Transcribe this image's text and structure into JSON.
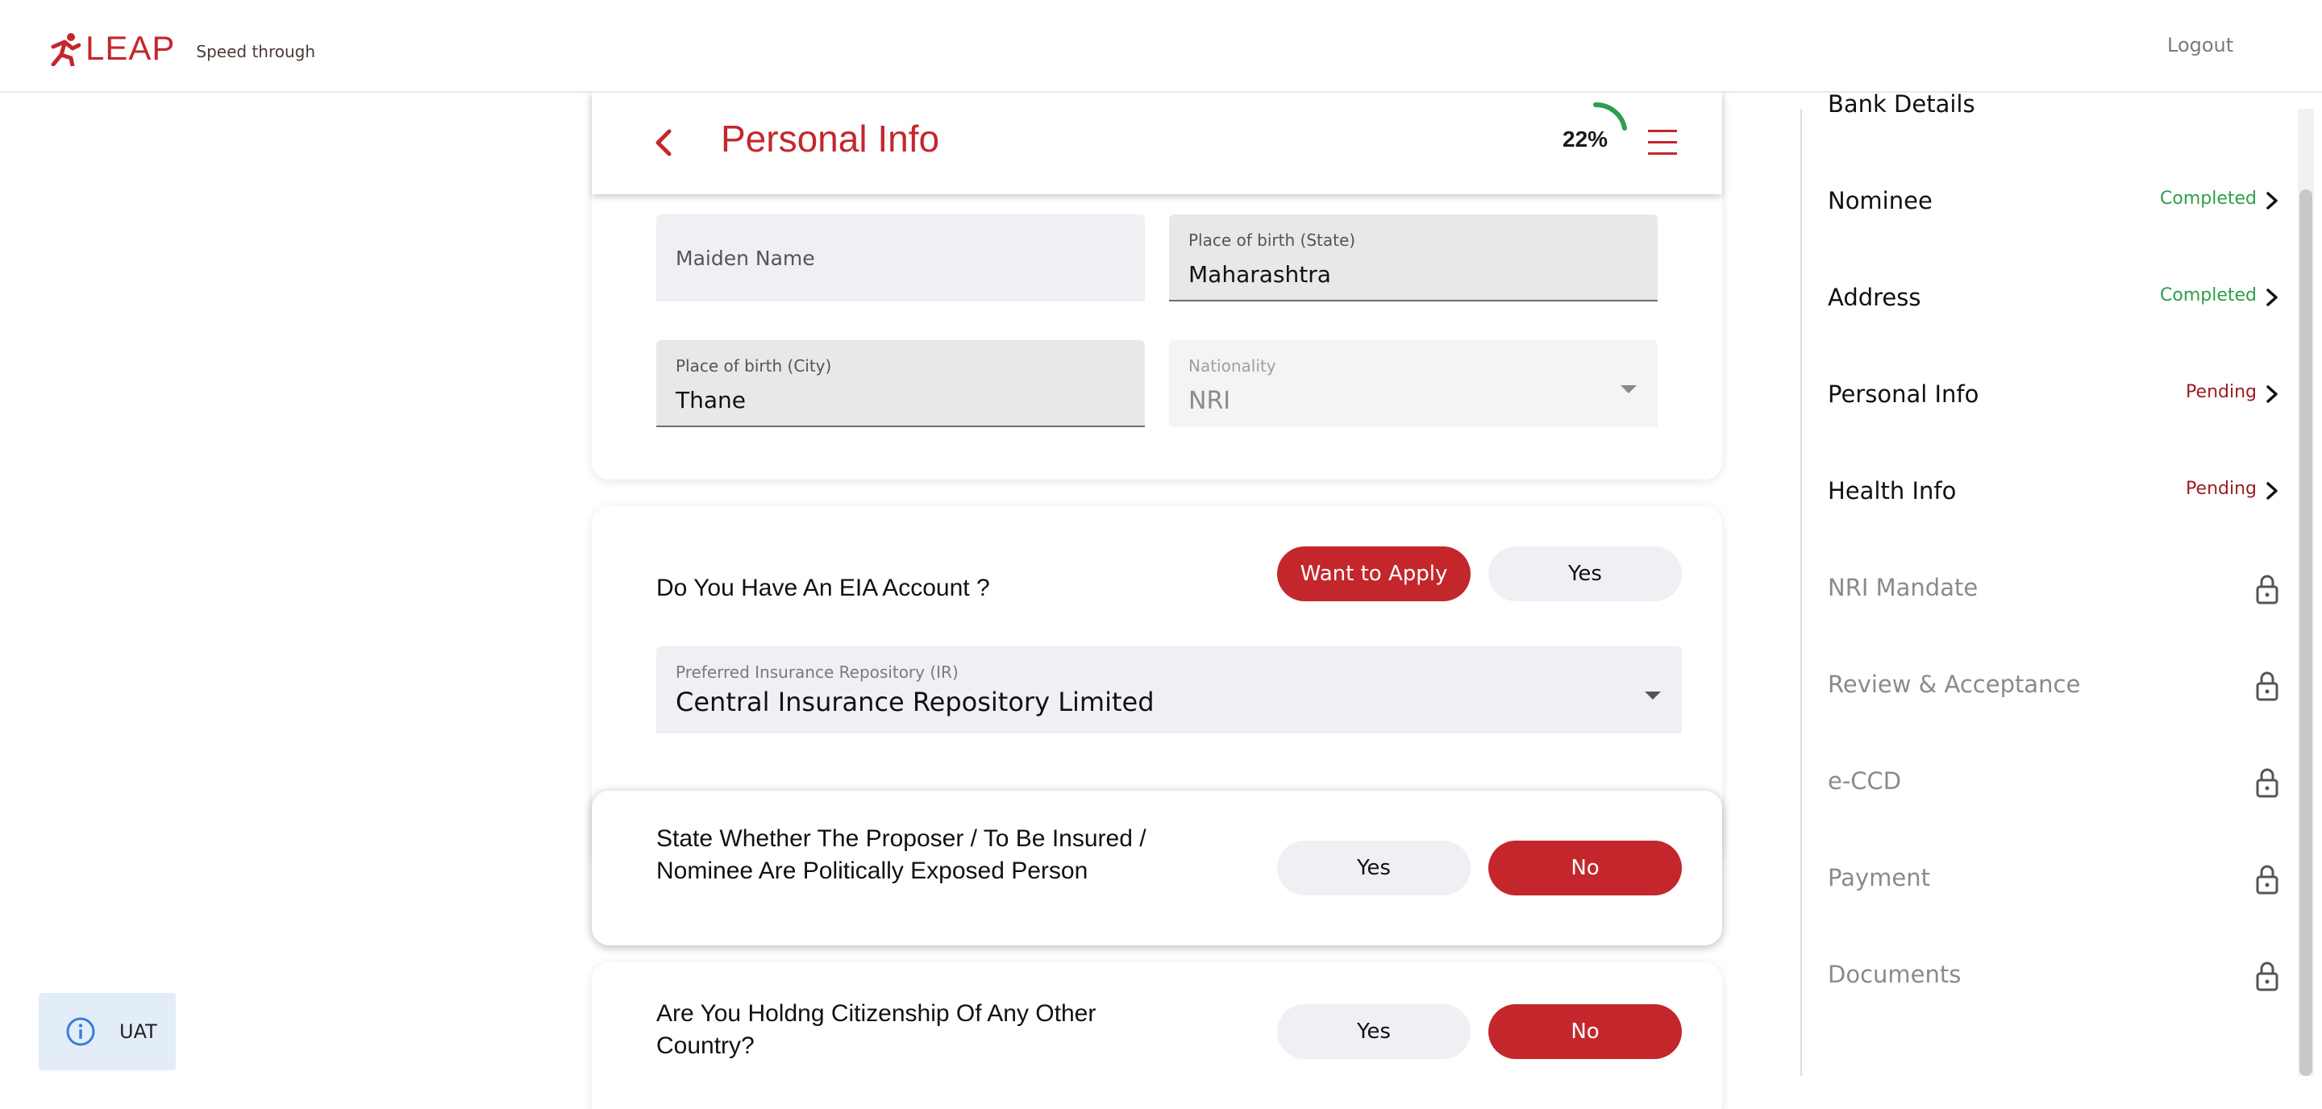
{
  "brand": {
    "name": "LEAP",
    "tagline": "Speed through"
  },
  "topbar": {
    "logout_label": "Logout"
  },
  "page": {
    "title": "Personal Info",
    "progress_label": "22%",
    "progress_percent": 22
  },
  "form": {
    "maiden_name_placeholder": "Maiden Name",
    "birth_state_label": "Place of birth (State)",
    "birth_state_value": "Maharashtra",
    "birth_city_label": "Place of birth (City)",
    "birth_city_value": "Thane",
    "nationality_label": "Nationality",
    "nationality_value": "NRI"
  },
  "eia": {
    "question": "Do You Have An EIA Account ?",
    "option_want": "Want to Apply",
    "option_yes": "Yes",
    "selected": "Want to Apply",
    "repository_label": "Preferred Insurance Repository (IR)",
    "repository_value": "Central Insurance Repository Limited"
  },
  "pep": {
    "question_line1": "State Whether The Proposer / To Be Insured /",
    "question_line2": "Nominee Are Politically Exposed Person",
    "option_yes": "Yes",
    "option_no": "No",
    "selected": "No"
  },
  "citizenship": {
    "question_line1": "Are You Holdng Citizenship Of Any Other",
    "question_line2": "Country?",
    "option_yes": "Yes",
    "option_no": "No",
    "selected": "No"
  },
  "sidebar": {
    "steps": [
      {
        "name": "Bank Details",
        "status": "",
        "state": "clipped"
      },
      {
        "name": "Nominee",
        "status": "Completed",
        "state": "completed"
      },
      {
        "name": "Address",
        "status": "Completed",
        "state": "completed"
      },
      {
        "name": "Personal Info",
        "status": "Pending",
        "state": "pending"
      },
      {
        "name": "Health Info",
        "status": "Pending",
        "state": "pending"
      },
      {
        "name": "NRI Mandate",
        "status": "",
        "state": "locked"
      },
      {
        "name": "Review & Acceptance",
        "status": "",
        "state": "locked"
      },
      {
        "name": "e-CCD",
        "status": "",
        "state": "locked"
      },
      {
        "name": "Payment",
        "status": "",
        "state": "locked"
      },
      {
        "name": "Documents",
        "status": "",
        "state": "locked"
      }
    ]
  },
  "env_badge": {
    "label": "UAT",
    "icon": "info-icon"
  },
  "colors": {
    "brand_red": "#c3272c",
    "completed_green": "#2e9e4a",
    "pending_red": "#9b1c1f"
  }
}
